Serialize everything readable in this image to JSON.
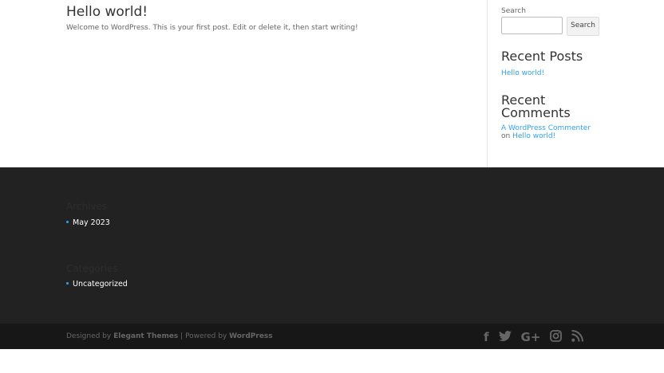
{
  "post": {
    "title": "Hello world!",
    "excerpt": "Welcome to WordPress. This is your first post. Edit or delete it, then start writing!"
  },
  "sidebar": {
    "search_label": "Search",
    "search_button": "Search",
    "recent_posts_title": "Recent Posts",
    "recent_posts": [
      "Hello world!"
    ],
    "recent_comments_title": "Recent Comments",
    "recent_comment": {
      "author": "A WordPress Commenter",
      "on": "on",
      "post": "Hello world!"
    }
  },
  "footer": {
    "archives_title": "Archives",
    "archives": [
      "May 2023"
    ],
    "categories_title": "Categories",
    "categories": [
      "Uncategorized"
    ]
  },
  "bottom": {
    "designed_by": "Designed by",
    "theme": "Elegant Themes",
    "sep": "| Powered by",
    "wp": "WordPress"
  },
  "socials": [
    "facebook-icon",
    "twitter-icon",
    "google-plus-icon",
    "instagram-icon",
    "rss-icon"
  ]
}
